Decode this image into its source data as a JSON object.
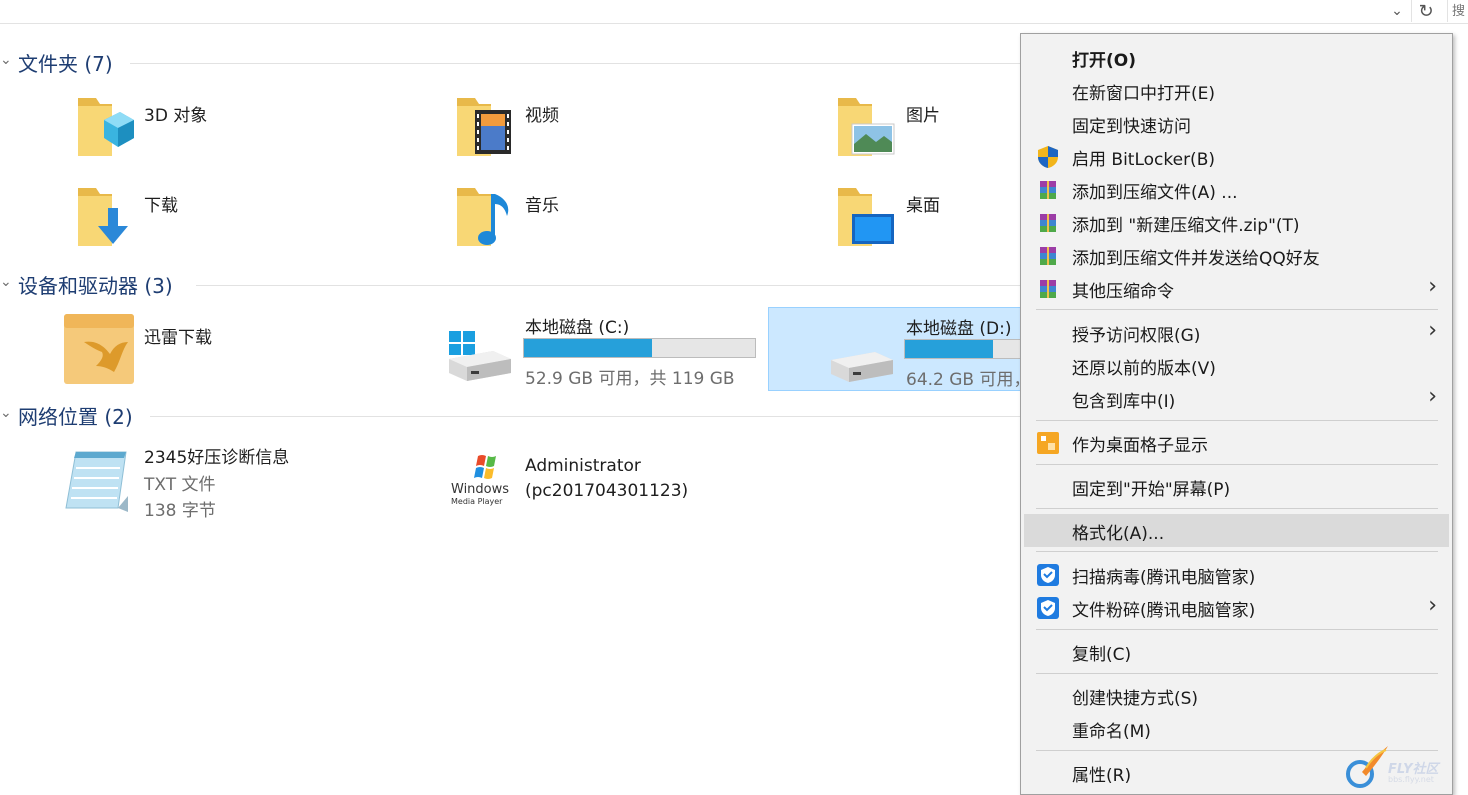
{
  "search_partial": "搜",
  "groups": {
    "folders": {
      "title": "文件夹 (7)"
    },
    "devices": {
      "title": "设备和驱动器 (3)"
    },
    "network": {
      "title": "网络位置 (2)"
    }
  },
  "folders": [
    {
      "name": "3D 对象",
      "icon": "3d-objects-folder-icon"
    },
    {
      "name": "视频",
      "icon": "videos-folder-icon"
    },
    {
      "name": "图片",
      "icon": "pictures-folder-icon"
    },
    {
      "name": "下载",
      "icon": "downloads-folder-icon"
    },
    {
      "name": "音乐",
      "icon": "music-folder-icon"
    },
    {
      "name": "桌面",
      "icon": "desktop-folder-icon"
    }
  ],
  "devices": [
    {
      "name": "迅雷下载",
      "icon": "thunder-download-icon"
    },
    {
      "name": "本地磁盘 (C:)",
      "space": "52.9 GB 可用，共 119 GB",
      "used_fraction": 0.555,
      "icon": "system-drive-icon"
    },
    {
      "name": "本地磁盘 (D:)",
      "space": "64.2 GB 可用，",
      "used_fraction": 0.38,
      "icon": "drive-icon",
      "selected": true
    }
  ],
  "network": [
    {
      "name": "2345好压诊断信息",
      "type": "TXT 文件",
      "size": "138 字节",
      "icon": "notepad-icon"
    },
    {
      "name": "Administrator",
      "host": "(pc201704301123)",
      "icon": "windows-media-player-icon"
    }
  ],
  "wmp_logo": {
    "line1": "Windows",
    "line2": "Media Player"
  },
  "menu": {
    "items": [
      {
        "label": "打开(O)",
        "bold": true
      },
      {
        "label": "在新窗口中打开(E)"
      },
      {
        "label": "固定到快速访问"
      },
      {
        "label": "启用 BitLocker(B)",
        "icon": "uac-shield-icon"
      },
      {
        "label": "添加到压缩文件(A) ...",
        "icon": "archive-icon"
      },
      {
        "label": "添加到 \"新建压缩文件.zip\"(T)",
        "icon": "archive-icon"
      },
      {
        "label": "添加到压缩文件并发送给QQ好友",
        "icon": "archive-icon"
      },
      {
        "label": "其他压缩命令",
        "icon": "archive-icon",
        "submenu": true
      },
      {
        "label": "授予访问权限(G)",
        "submenu": true
      },
      {
        "label": "还原以前的版本(V)"
      },
      {
        "label": "包含到库中(I)",
        "submenu": true
      },
      {
        "label": "作为桌面格子显示",
        "icon": "desktop-grid-icon"
      },
      {
        "label": "固定到\"开始\"屏幕(P)"
      },
      {
        "label": "格式化(A)...",
        "highlighted": true
      },
      {
        "label": "扫描病毒(腾讯电脑管家)",
        "icon": "tencent-shield-icon"
      },
      {
        "label": "文件粉碎(腾讯电脑管家)",
        "icon": "tencent-shield-icon",
        "submenu": true
      },
      {
        "label": "复制(C)"
      },
      {
        "label": "创建快捷方式(S)"
      },
      {
        "label": "重命名(M)"
      },
      {
        "label": "属性(R)"
      }
    ]
  },
  "watermark": {
    "text": "FLY社区",
    "sub": "bbs.flyy.net"
  },
  "colors": {
    "accent": "#26a0da",
    "header": "#1e3d72",
    "selection": "#cce8ff",
    "folder": "#f8d775"
  }
}
